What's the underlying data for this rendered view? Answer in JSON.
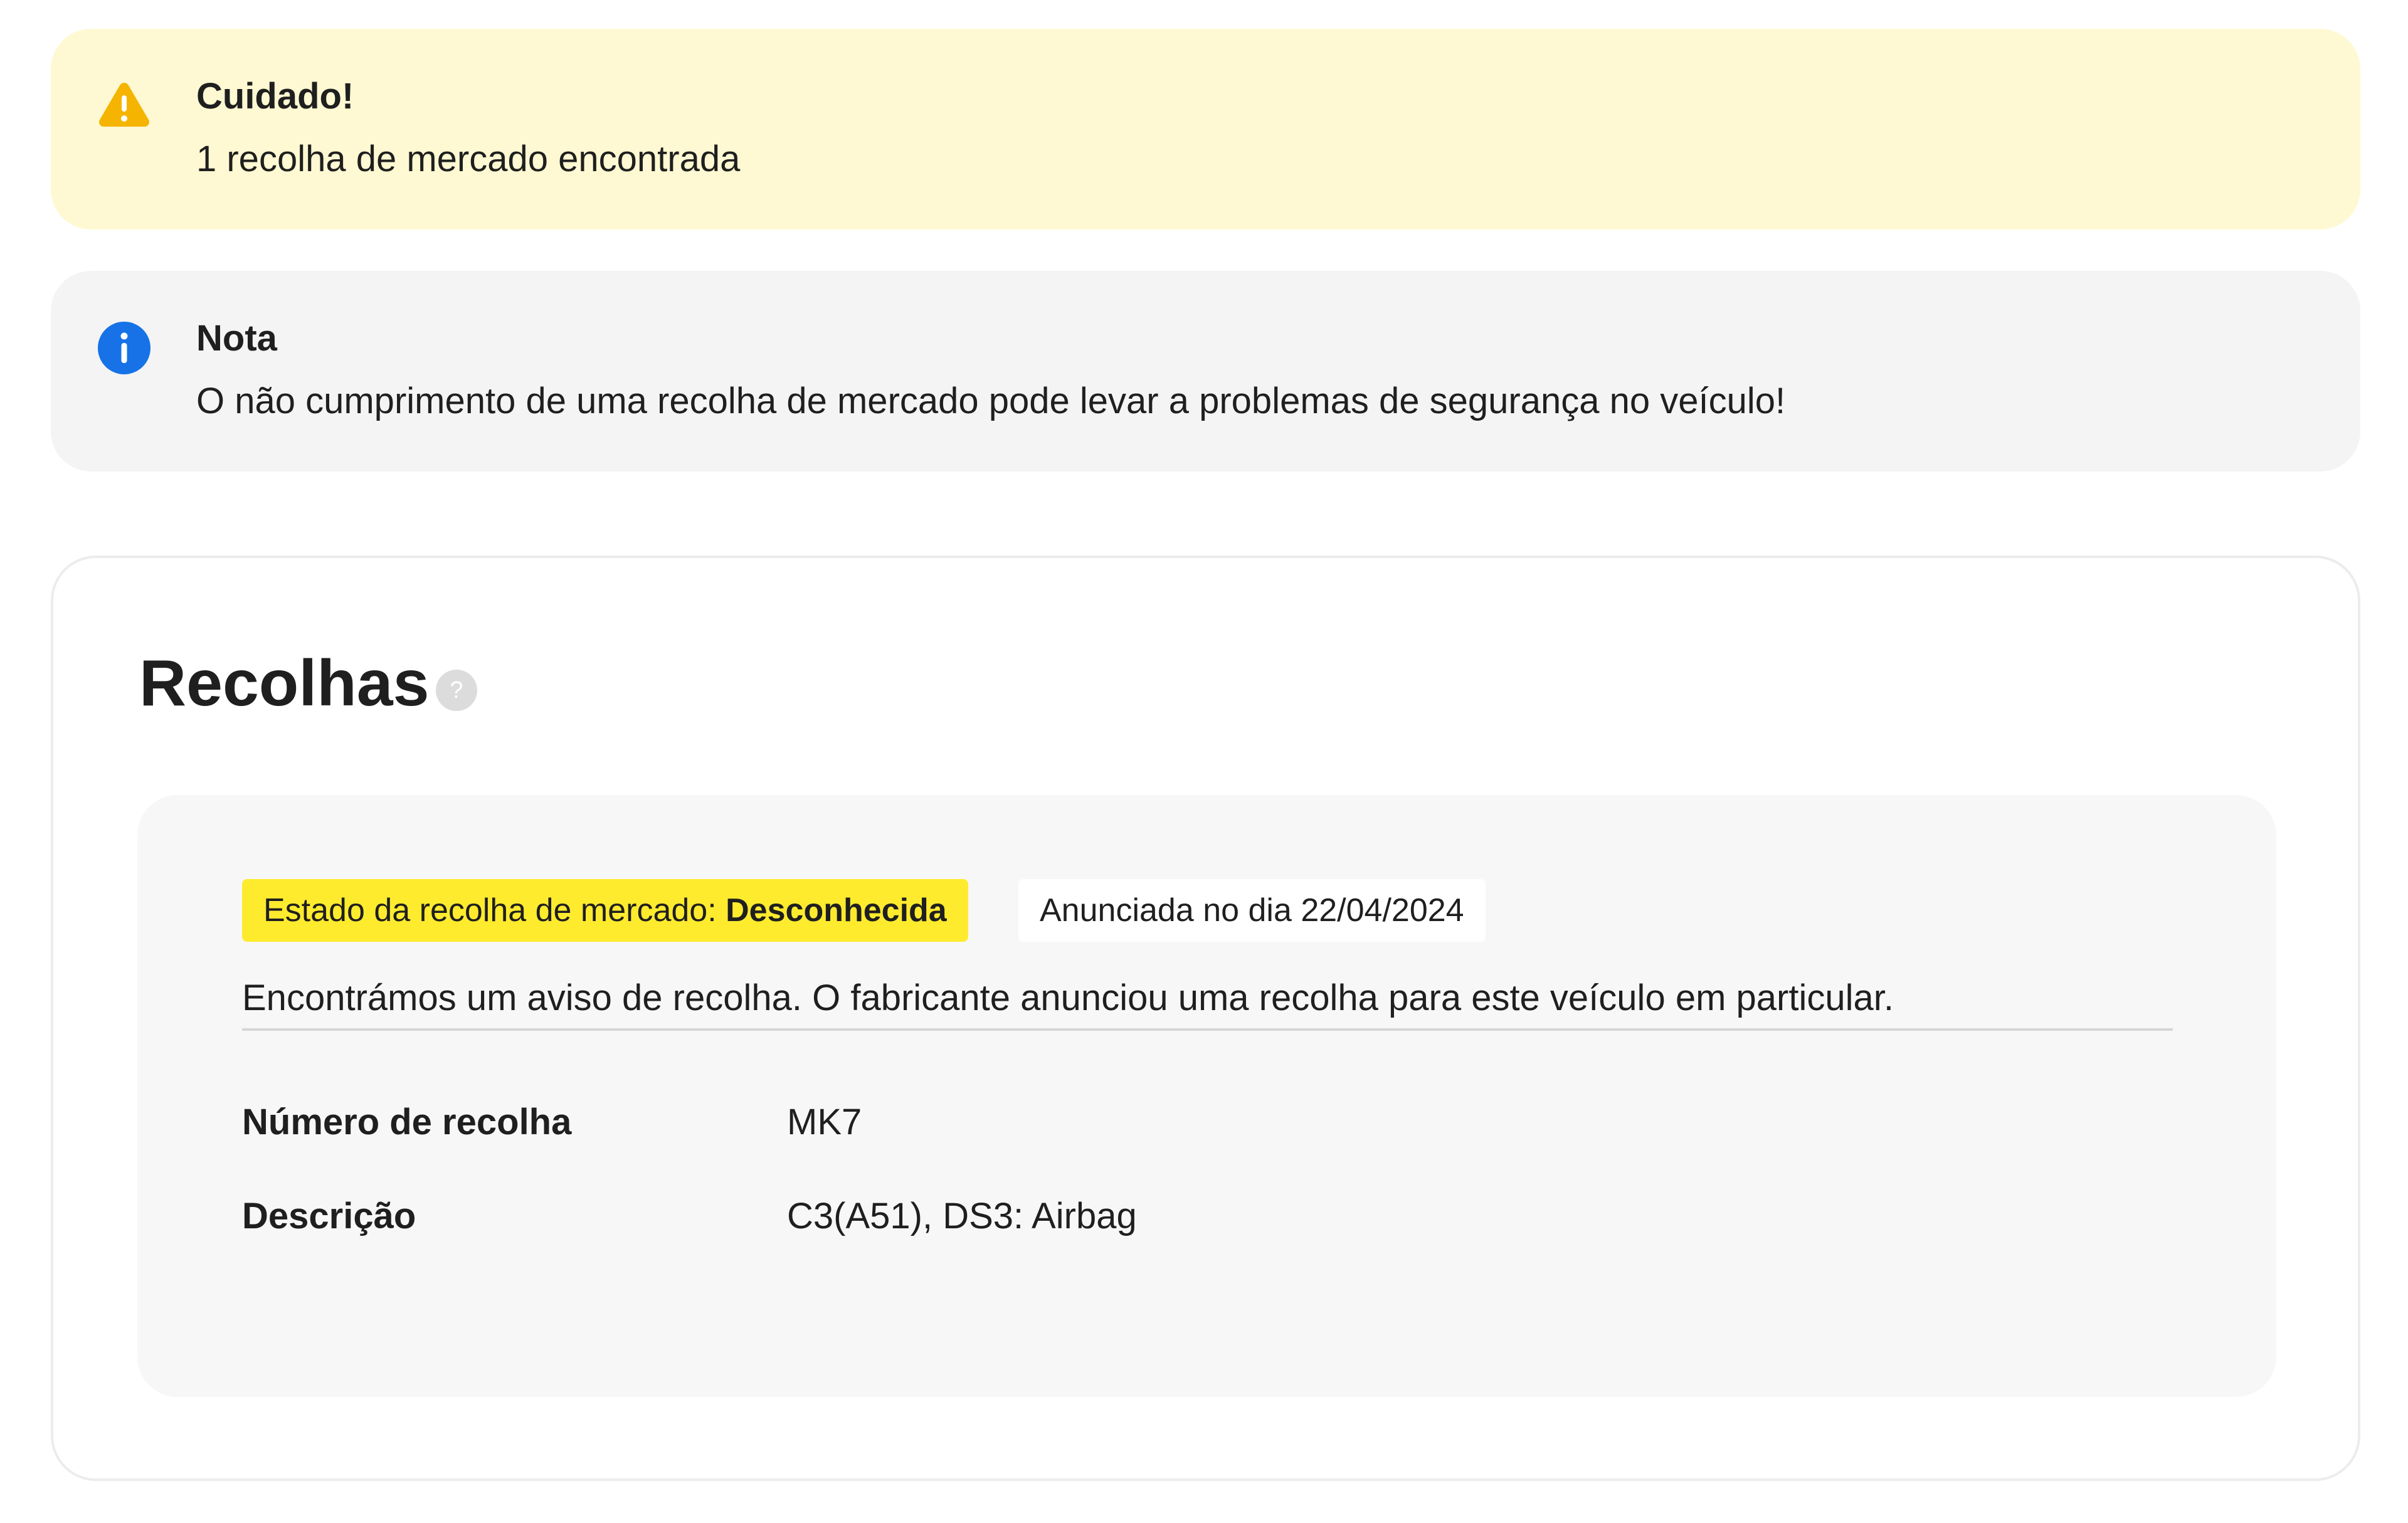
{
  "warning": {
    "title": "Cuidado!",
    "text": "1 recolha de mercado encontrada",
    "icon": "warning-icon",
    "color": "#f5b400"
  },
  "note": {
    "title": "Nota",
    "text": "O não cumprimento de uma recolha de mercado pode levar a problemas de segurança no veículo!",
    "icon": "info-icon",
    "color": "#1672e6"
  },
  "recalls": {
    "title": "Recolhas",
    "help_icon": "help-icon",
    "items": [
      {
        "status_label": "Estado da recolha de mercado:",
        "status_value": "Desconhecida",
        "status_color": "#ffeb2e",
        "announced": "Anunciada no dia 22/04/2024",
        "summary": "Encontrámos um aviso de recolha. O fabricante anunciou uma recolha para este veículo em particular.",
        "details": [
          {
            "label": "Número de recolha",
            "value": "MK7"
          },
          {
            "label": "Descrição",
            "value": "C3(A51), DS3: Airbag"
          }
        ]
      }
    ]
  }
}
